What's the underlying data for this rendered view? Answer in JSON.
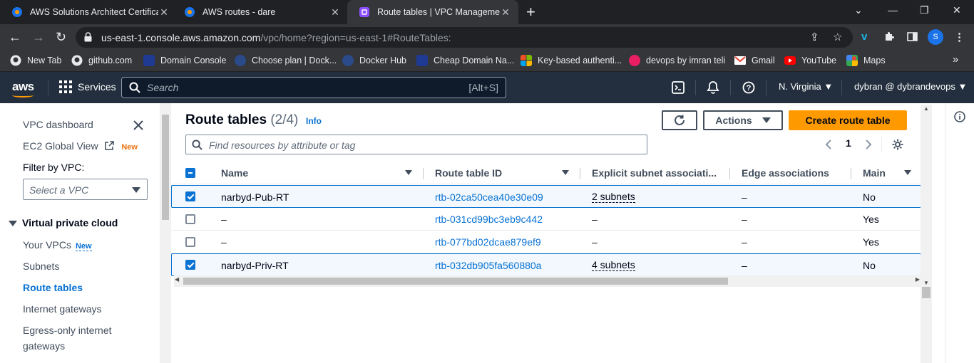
{
  "browser": {
    "tabs": [
      {
        "title": "AWS Solutions Architect Certifica",
        "active": false
      },
      {
        "title": "AWS routes - dare",
        "active": false
      },
      {
        "title": "Route tables | VPC Management",
        "active": true
      }
    ],
    "url_host": "us-east-1.console.aws.amazon.com",
    "url_path": "/vpc/home?region=us-east-1#RouteTables:",
    "profile_initial": "S",
    "bookmarks": [
      {
        "label": "New Tab",
        "color": "#e8eaed"
      },
      {
        "label": "github.com",
        "color": "#e8eaed"
      },
      {
        "label": "Domain Console",
        "color": "#1f3a93"
      },
      {
        "label": "Choose plan | Dock...",
        "color": "#1d63ed"
      },
      {
        "label": "Docker Hub",
        "color": "#1d63ed"
      },
      {
        "label": "Cheap Domain Na...",
        "color": "#1f3a93"
      },
      {
        "label": "Key-based authenti...",
        "color": "#f25022"
      },
      {
        "label": "devops by imran teli",
        "color": "#e91e63"
      },
      {
        "label": "Gmail",
        "color": "#ea4335"
      },
      {
        "label": "YouTube",
        "color": "#ff0000"
      },
      {
        "label": "Maps",
        "color": "#34a853"
      }
    ],
    "more_bookmarks": "»"
  },
  "aws_nav": {
    "logo": "aws",
    "services_label": "Services",
    "search_placeholder": "Search",
    "search_shortcut": "[Alt+S]",
    "region": "N. Virginia",
    "account": "dybran @ dybrandevops"
  },
  "sidenav": {
    "dashboard": "VPC dashboard",
    "ec2_global_view": "EC2 Global View",
    "new_badge": "New",
    "filter_label": "Filter by VPC:",
    "vpc_select_placeholder": "Select a VPC",
    "section_title": "Virtual private cloud",
    "items": [
      {
        "label": "Your VPCs",
        "badge": "New",
        "active": false
      },
      {
        "label": "Subnets",
        "badge": "",
        "active": false
      },
      {
        "label": "Route tables",
        "badge": "",
        "active": true
      },
      {
        "label": "Internet gateways",
        "badge": "",
        "active": false
      },
      {
        "label": "Egress-only internet",
        "badge": "",
        "active": false
      },
      {
        "label": "gateways",
        "badge": "",
        "active": false
      }
    ]
  },
  "main": {
    "title": "Route tables",
    "count": "(2/4)",
    "info_link": "Info",
    "actions_label": "Actions",
    "create_label": "Create route table",
    "find_placeholder": "Find resources by attribute or tag",
    "page_number": "1",
    "columns": [
      "Name",
      "Route table ID",
      "Explicit subnet associati...",
      "Edge associations",
      "Main"
    ],
    "rows": [
      {
        "selected": true,
        "name": "narbyd-Pub-RT",
        "id": "rtb-02ca50cea40e30e09",
        "subnets": "2 subnets",
        "edge": "–",
        "main": "No"
      },
      {
        "selected": false,
        "name": "–",
        "id": "rtb-031cd99bc3eb9c442",
        "subnets": "–",
        "edge": "–",
        "main": "Yes"
      },
      {
        "selected": false,
        "name": "–",
        "id": "rtb-077bd02dcae879ef9",
        "subnets": "–",
        "edge": "–",
        "main": "Yes"
      },
      {
        "selected": true,
        "name": "narbyd-Priv-RT",
        "id": "rtb-032db905fa560880a",
        "subnets": "4 subnets",
        "edge": "–",
        "main": "No"
      }
    ]
  },
  "colors": {
    "aws_nav_bg": "#232f3e",
    "aws_orange": "#ff9900",
    "link_blue": "#0972d3",
    "chrome_dark": "#202124"
  }
}
